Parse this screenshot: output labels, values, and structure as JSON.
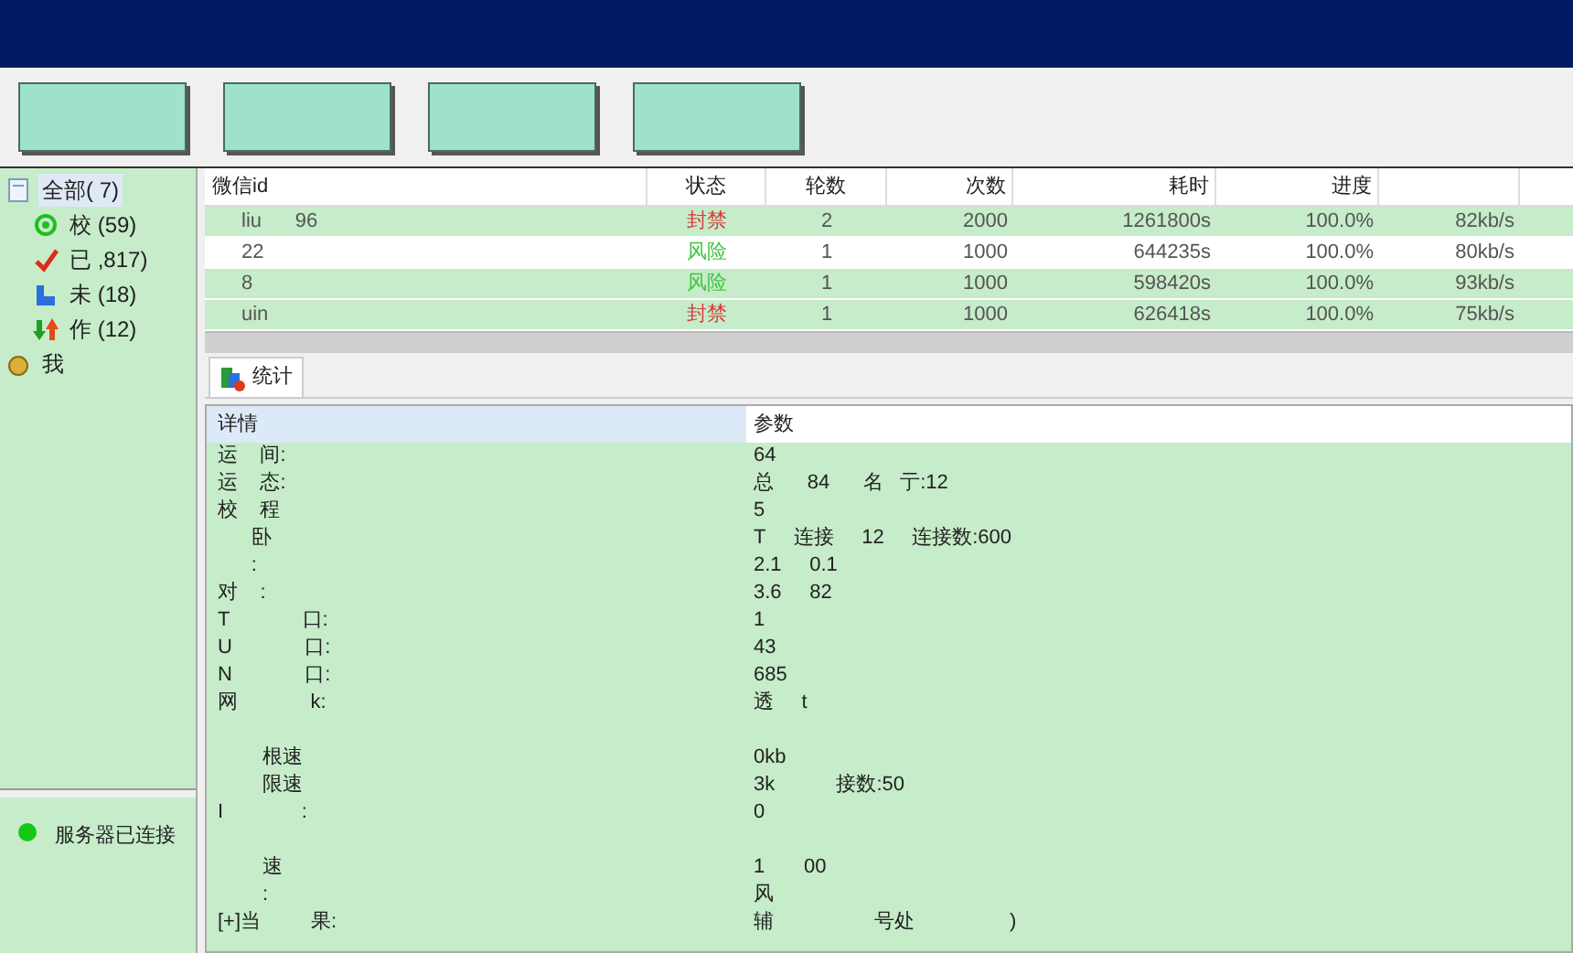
{
  "toolbar": {
    "buttons": [
      {
        "kind": "plain"
      },
      {
        "kind": "plain"
      },
      {
        "kind": "plain"
      },
      {
        "kind": "plain"
      }
    ]
  },
  "sidebar": {
    "items": [
      {
        "label": "全部(",
        "count": "7)",
        "selected": true,
        "kind": "doc",
        "children": [
          {
            "label": "校",
            "count": "(59)",
            "selected": false,
            "kind": "target"
          },
          {
            "label": "已",
            "count": ",817)",
            "selected": false,
            "kind": "check"
          },
          {
            "label": "未",
            "count": "(18)",
            "selected": false,
            "kind": "block"
          },
          {
            "label": "作",
            "count": "(12)",
            "selected": false,
            "kind": "arrows"
          }
        ]
      },
      {
        "label": "我",
        "selected": false,
        "kind": "coin"
      }
    ]
  },
  "status": {
    "connected": true,
    "text": "服务器已连接"
  },
  "table": {
    "columns": [
      "微信id",
      "状态",
      "轮数",
      "次数",
      "耗时",
      "进度"
    ],
    "rows": [
      {
        "id": "liu      96",
        "status": "封禁",
        "color": "#d83a3a",
        "rounds": "2",
        "count": "2000",
        "time": "1261800s",
        "progress": "100.0%",
        "speed": "82kb/s",
        "selected": false
      },
      {
        "id": "22",
        "status": "风险",
        "color": "#43c443",
        "rounds": "1",
        "count": "1000",
        "time": "644235s",
        "progress": "100.0%",
        "speed": "80kb/s",
        "selected": true
      },
      {
        "id": "8",
        "status": "风险",
        "color": "#43c443",
        "rounds": "1",
        "count": "1000",
        "time": "598420s",
        "progress": "100.0%",
        "speed": "93kb/s",
        "selected": false
      },
      {
        "id": "uin",
        "status": "封禁",
        "color": "#d83a3a",
        "rounds": "1",
        "count": "1000",
        "time": "626418s",
        "progress": "100.0%",
        "speed": "75kb/s",
        "selected": false
      }
    ]
  },
  "tab": {
    "label": "统计",
    "selected": true
  },
  "details": {
    "columns": [
      "详情",
      "参数"
    ],
    "rows": [
      {
        "label": "运    间:",
        "value": "64"
      },
      {
        "label": "运    态:",
        "value": "总      84      名   亍:12"
      },
      {
        "label": "校    程",
        "value": "5"
      },
      {
        "label": "      卧",
        "value": "T     连接     12     连接数:600"
      },
      {
        "label": "      :",
        "value": "2.1     0.1"
      },
      {
        "label": "对    :",
        "value": "3.6     82"
      },
      {
        "label": "T             口:",
        "value": "1"
      },
      {
        "label": "U             口:",
        "value": "43"
      },
      {
        "label": "N             口:",
        "value": "685"
      },
      {
        "label": "网             k:",
        "value": "透     t"
      },
      {
        "label": "",
        "value": ""
      },
      {
        "label": "        根速",
        "value": "0kb"
      },
      {
        "label": "        限速",
        "value": "3k           接数:50"
      },
      {
        "label": "I              :",
        "value": "0"
      },
      {
        "label": "",
        "value": ""
      },
      {
        "label": "        速",
        "value": "1       00"
      },
      {
        "label": "        :",
        "value": "风"
      },
      {
        "label": "[+]当         果:",
        "value": "辅                  号处                 )"
      }
    ]
  }
}
